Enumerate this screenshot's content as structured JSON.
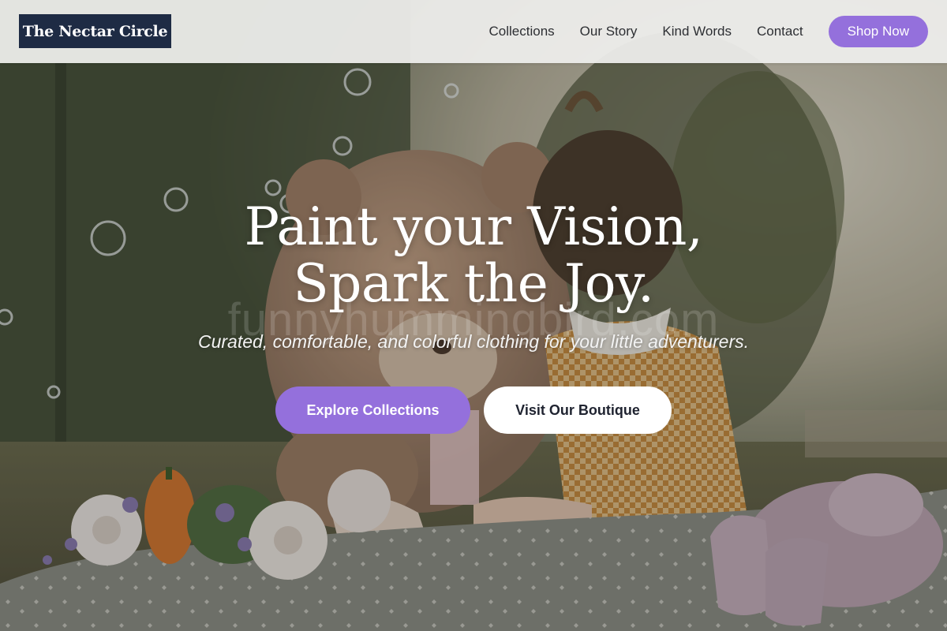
{
  "header": {
    "logo_text": "The Nectar Circle",
    "nav": [
      {
        "label": "Collections"
      },
      {
        "label": "Our Story"
      },
      {
        "label": "Kind Words"
      },
      {
        "label": "Contact"
      }
    ],
    "cta_label": "Shop Now"
  },
  "hero": {
    "headline_line1": "Paint your Vision,",
    "headline_line2": "Spark the Joy.",
    "tagline": "Curated, comfortable, and colorful clothing for your little adventurers.",
    "primary_button": "Explore Collections",
    "secondary_button": "Visit Our Boutique",
    "watermark": "funnyhummingbird.com"
  },
  "colors": {
    "accent": "#9470dc",
    "logo_bg": "#1e2b44",
    "header_bg": "#eeeeec"
  }
}
